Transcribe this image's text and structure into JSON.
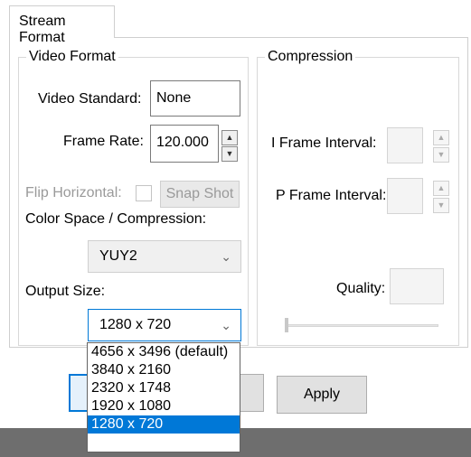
{
  "tab": {
    "label": "Stream Format"
  },
  "video_format": {
    "legend": "Video Format",
    "video_standard": {
      "label": "Video Standard:",
      "value": "None"
    },
    "frame_rate": {
      "label": "Frame Rate:",
      "value": "120.000",
      "up": "▲",
      "down": "▼"
    },
    "flip_horizontal": {
      "label": "Flip Horizontal:"
    },
    "snap_shot": {
      "label": "Snap Shot"
    },
    "color_space": {
      "label": "Color Space / Compression:",
      "value": "YUY2",
      "chevron": "⌄"
    },
    "output_size": {
      "label": "Output Size:",
      "value": "1280 x 720",
      "chevron": "⌄",
      "options": [
        "4656 x 3496  (default)",
        "3840 x 2160",
        "2320 x 1748",
        "1920 x 1080",
        "1280 x 720"
      ],
      "selected_index": 4
    }
  },
  "compression": {
    "legend": "Compression",
    "i_frame_interval": {
      "label": "I Frame Interval:",
      "up": "▲",
      "down": "▼"
    },
    "p_frame_interval": {
      "label": "P Frame Interval:",
      "up": "▲",
      "down": "▼"
    },
    "quality": {
      "label": "Quality:"
    }
  },
  "buttons": {
    "apply": "Apply"
  },
  "colors": {
    "accent": "#0078d7",
    "disabled_text": "#9a9a9a",
    "border": "#cfcfcf"
  }
}
